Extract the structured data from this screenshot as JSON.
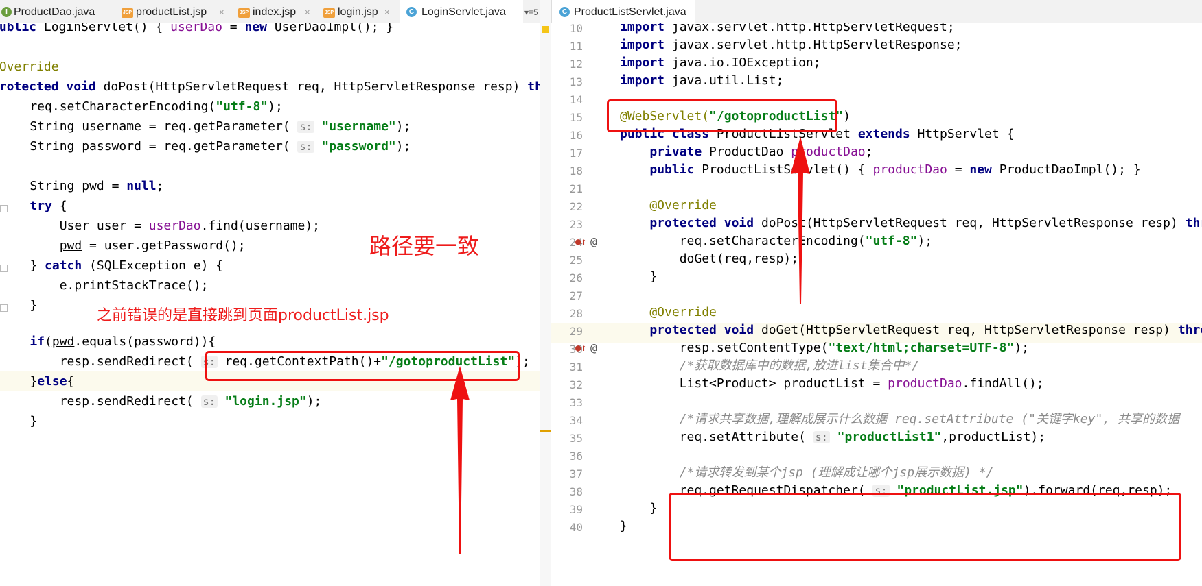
{
  "left_tabs": [
    {
      "icon": "I",
      "label": "ProductDao.java"
    },
    {
      "icon": "JSP",
      "label": "productList.jsp"
    },
    {
      "icon": "JSP",
      "label": "index.jsp"
    },
    {
      "icon": "JSP",
      "label": "login.jsp"
    },
    {
      "icon": "C",
      "label": "LoginServlet.java"
    }
  ],
  "left_tab_close": "×",
  "left_overflow": "▾≡5",
  "right_tabs": [
    {
      "icon": "C",
      "label": "ProductListServlet.java"
    }
  ],
  "left_code": {
    "l1a": "public ",
    "l1b": "LoginServlet() ",
    "l1c": "{ ",
    "l1d": "userDao",
    "l1e": " = ",
    "l1f": "new ",
    "l1g": "UserDaoImpl(); }",
    "l3": "@Override",
    "l4a": "protected void ",
    "l4b": "doPost(HttpServletRequest req, HttpServletResponse resp) ",
    "l4c": "throws",
    "l5a": "    req.setCharacterEncoding(",
    "l5b": "\"utf-8\"",
    "l5c": ");",
    "l6a": "    String username = req.getParameter( ",
    "l6h": "s:",
    "l6b": " \"username\"",
    "l6c": ");",
    "l7a": "    String password = req.getParameter( ",
    "l7h": "s:",
    "l7b": " \"password\"",
    "l7c": ");",
    "l9a": "    String ",
    "l9b": "pwd",
    "l9c": " = ",
    "l9d": "null",
    "l9e": ";",
    "l10a": "    ",
    "l10b": "try",
    "l10c": " {",
    "l11a": "        User user = ",
    "l11b": "userDao",
    "l11c": ".find(username);",
    "l12a": "        ",
    "l12b": "pwd",
    "l12c": " = user.getPassword();",
    "l13a": "    } ",
    "l13b": "catch",
    "l13c": " (SQLException e) {",
    "l14": "        e.printStackTrace();",
    "l15": "    }",
    "l17a": "    ",
    "l17b": "if",
    "l17c": "(",
    "l17d": "pwd",
    "l17e": ".equals(password)){",
    "l18a": "        resp.sendRedirect( ",
    "l18h": "s:",
    "l18b": " req.getContextPath()+",
    "l18c": "\"/gotoproductList\"",
    "l18d": ");",
    "l19a": "    }",
    "l19b": "else",
    "l19c": "{",
    "l20a": "        resp.sendRedirect( ",
    "l20h": "s:",
    "l20b": " \"login.jsp\"",
    "l20c": ");",
    "l21": "    }",
    "l22": "}"
  },
  "right_code": [
    {
      "n": "10",
      "a": "import javax.servlet.http.HttpServletRequest;"
    },
    {
      "n": "11",
      "a": "import javax.servlet.http.HttpServletResponse;"
    },
    {
      "n": "12",
      "a": "import java.io.IOException;"
    },
    {
      "n": "13",
      "a": "import java.util.List;"
    },
    {
      "n": "14",
      "a": ""
    },
    {
      "n": "15",
      "a": "@WebServlet(",
      "s": "\"/gotoproductList\"",
      "c": ")"
    },
    {
      "n": "16",
      "a": "public class ProductListServlet extends HttpServlet {"
    },
    {
      "n": "17",
      "a": "    private ProductDao productDao;"
    },
    {
      "n": "18",
      "a": "    public ProductListServlet() { productDao = new ProductDaoImpl(); }"
    },
    {
      "n": "21",
      "a": ""
    },
    {
      "n": "22",
      "a": "    @Override"
    },
    {
      "n": "23",
      "a": "    protected void doPost(HttpServletRequest req, HttpServletResponse resp) throws"
    },
    {
      "n": "24",
      "a": "        req.setCharacterEncoding(",
      "s": "\"utf-8\"",
      "c": ");"
    },
    {
      "n": "25",
      "a": "        doGet(req,resp);"
    },
    {
      "n": "26",
      "a": "    }"
    },
    {
      "n": "27",
      "a": ""
    },
    {
      "n": "28",
      "a": "    @Override"
    },
    {
      "n": "29",
      "a": "    protected void doGet(HttpServletRequest req, HttpServletResponse resp) throws"
    },
    {
      "n": "30",
      "a": "        resp.setContentType(",
      "s": "\"text/html;charset=UTF-8\"",
      "c": ");"
    },
    {
      "n": "31",
      "a": "        /*获取数据库中的数据,放进list集合中*/"
    },
    {
      "n": "32",
      "a": "        List<Product> productList = productDao.findAll();"
    },
    {
      "n": "33",
      "a": ""
    },
    {
      "n": "34",
      "a": "        /*请求共享数据,理解成展示什么数据 req.setAttribute (\"关键字key\", 共享的数据"
    },
    {
      "n": "35",
      "a": "        req.setAttribute( s: ",
      "s": "\"productList1\"",
      "c": ",productList);"
    },
    {
      "n": "36",
      "a": ""
    },
    {
      "n": "37",
      "a": "        /*请求转发到某个jsp (理解成让哪个jsp展示数据) */"
    },
    {
      "n": "38",
      "a": "        req.getRequestDispatcher( s: ",
      "s": "\"productList.jsp\"",
      "c": ").forward(req,resp);"
    },
    {
      "n": "39",
      "a": "    }"
    },
    {
      "n": "40",
      "a": "}"
    }
  ],
  "annotations": {
    "path_note": "路径要一致",
    "error_note": "之前错误的是直接跳到页面productList.jsp"
  },
  "colors": {
    "annotation_red": "#ee1111",
    "keyword": "#000080",
    "string": "#067d17",
    "field": "#871094",
    "annotation_java": "#808000"
  }
}
